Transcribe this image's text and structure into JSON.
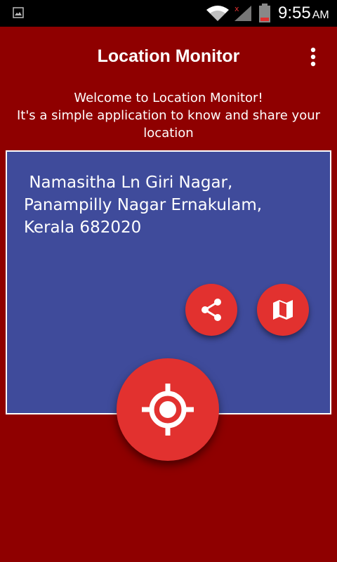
{
  "status_bar": {
    "time": "9:55",
    "ampm": "AM",
    "icons": [
      "gallery-icon",
      "wifi-icon",
      "signal-icon",
      "battery-icon"
    ]
  },
  "app_bar": {
    "title": "Location Monitor",
    "menu_icon": "more-vert-icon"
  },
  "welcome": {
    "line1": "Welcome to Location Monitor!",
    "line2": "It's a simple application to know and share your location"
  },
  "address": {
    "text": " Namasitha Ln Giri Nagar, Panampilly Nagar Ernakulam, Kerala 682020"
  },
  "actions": {
    "share_icon": "share-icon",
    "map_icon": "map-icon",
    "locate_icon": "gps-target-icon"
  },
  "colors": {
    "background": "#8f0000",
    "card": "#3f4b9b",
    "fab": "#e2312f",
    "status_bar": "#000000"
  }
}
